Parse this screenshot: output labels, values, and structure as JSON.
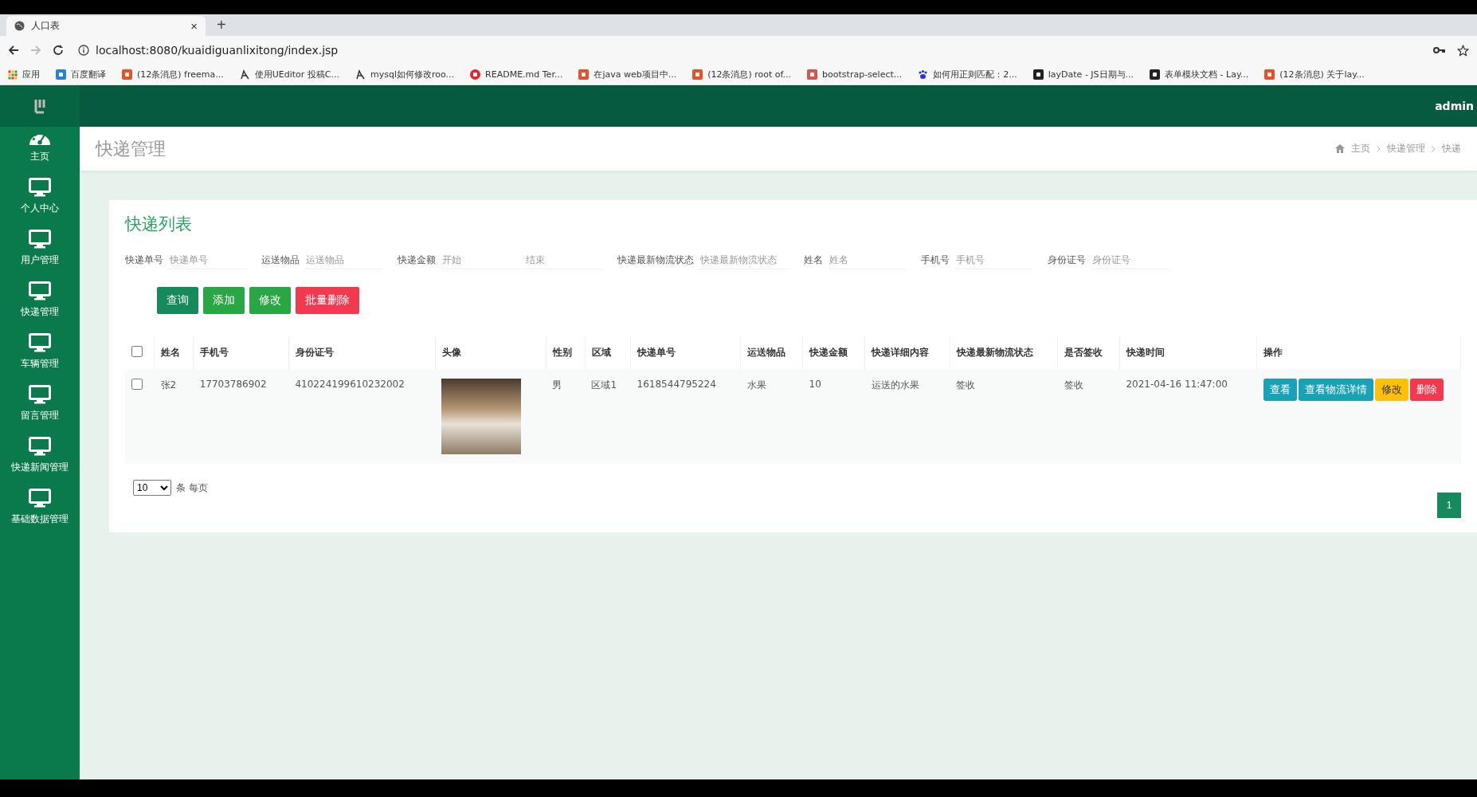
{
  "browser": {
    "tab": {
      "title": "人口表",
      "close": "×"
    },
    "new_tab": "+",
    "url": "localhost:8080/kuaidiguanlixitong/index.jsp",
    "bookmarks": [
      {
        "kind": "apps",
        "label": "应用"
      },
      {
        "kind": "translate",
        "label": "百度翻译"
      },
      {
        "kind": "csdn",
        "label": "(12条消息) freema..."
      },
      {
        "kind": "github",
        "label": "使用UEditor 投稿C..."
      },
      {
        "kind": "github",
        "label": "mysql如何修改roo..."
      },
      {
        "kind": "google",
        "label": "README.md  Ter..."
      },
      {
        "kind": "csdn",
        "label": "在java web项目中..."
      },
      {
        "kind": "csdn",
        "label": "(12条消息) root of..."
      },
      {
        "kind": "bootstrap",
        "label": "bootstrap-select..."
      },
      {
        "kind": "baidu",
        "label": "如何用正则匹配：2..."
      },
      {
        "kind": "layui",
        "label": "layDate - JS日期与..."
      },
      {
        "kind": "layui",
        "label": "表单模块文档 - Lay..."
      },
      {
        "kind": "csdn",
        "label": "(12条消息) 关于lay..."
      }
    ]
  },
  "header": {
    "user": "admin"
  },
  "sidebar": {
    "items": [
      {
        "kind": "dashboard",
        "label": "主页"
      },
      {
        "kind": "monitor",
        "label": "个人中心"
      },
      {
        "kind": "monitor",
        "label": "用户管理"
      },
      {
        "kind": "monitor",
        "label": "快递管理"
      },
      {
        "kind": "monitor",
        "label": "车辆管理"
      },
      {
        "kind": "monitor",
        "label": "留言管理"
      },
      {
        "kind": "monitor",
        "label": "快递新闻管理"
      },
      {
        "kind": "monitor",
        "label": "基础数据管理"
      }
    ]
  },
  "page_title": "快递管理",
  "breadcrumb": [
    "主页",
    "快递管理",
    "快递"
  ],
  "card_title": "快递列表",
  "search": [
    {
      "label": "快递单号",
      "placeholders": [
        "快递单号"
      ]
    },
    {
      "label": "运送物品",
      "placeholders": [
        "运送物品"
      ]
    },
    {
      "label": "快递金额",
      "placeholders": [
        "开始",
        "结束"
      ]
    },
    {
      "label": "快递最新物流状态",
      "placeholders": [
        "快递最新物流状态"
      ]
    },
    {
      "label": "姓名",
      "placeholders": [
        "姓名"
      ]
    },
    {
      "label": "手机号",
      "placeholders": [
        "手机号"
      ]
    },
    {
      "label": "身份证号",
      "placeholders": [
        "身份证号"
      ]
    }
  ],
  "toolbar": [
    {
      "kind": "primary",
      "label": "查询"
    },
    {
      "kind": "success",
      "label": "添加"
    },
    {
      "kind": "success",
      "label": "修改"
    },
    {
      "kind": "danger",
      "label": "批量删除"
    }
  ],
  "table": {
    "columns": [
      "姓名",
      "手机号",
      "身份证号",
      "头像",
      "性别",
      "区域",
      "快递单号",
      "运送物品",
      "快递金额",
      "快递详细内容",
      "快递最新物流状态",
      "是否签收",
      "快递时间",
      "操作"
    ],
    "header_checked": false,
    "rows": [
      {
        "checked": false,
        "cells": [
          "张2",
          "17703786902",
          "410224199610232002",
          "",
          "男",
          "区域1",
          "1618544795224",
          "水果",
          "10",
          "运送的水果",
          "签收",
          "签收",
          "2021-04-16 11:47:00"
        ],
        "actions": [
          {
            "kind": "info",
            "label": "查看"
          },
          {
            "kind": "info",
            "label": "查看物流详情"
          },
          {
            "kind": "warning",
            "label": "修改"
          },
          {
            "kind": "danger",
            "label": "删除"
          }
        ]
      }
    ]
  },
  "page_size": {
    "value": "10",
    "suffix": "条 每页"
  },
  "pages": [
    {
      "label": "1",
      "selected": true
    }
  ]
}
